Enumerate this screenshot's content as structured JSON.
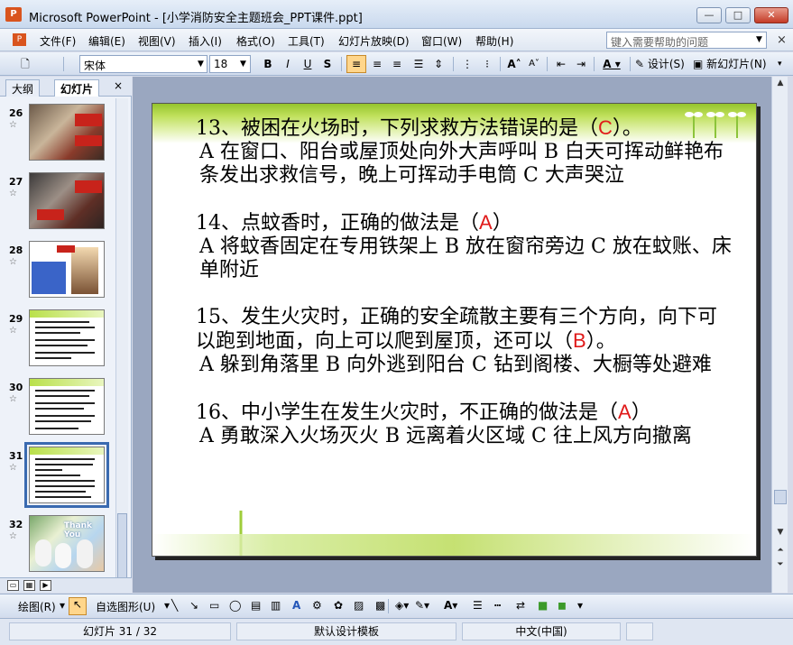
{
  "window": {
    "app_icon": "ppt-icon",
    "title": "Microsoft PowerPoint - [小学消防安全主题班会_PPT课件.ppt]",
    "minimize": "—",
    "maximize": "□",
    "close": "✕"
  },
  "menu": {
    "items": [
      "文件(F)",
      "编辑(E)",
      "视图(V)",
      "插入(I)",
      "格式(O)",
      "工具(T)",
      "幻灯片放映(D)",
      "窗口(W)",
      "帮助(H)"
    ],
    "help_placeholder": "键入需要帮助的问题",
    "close": "×"
  },
  "toolbar": {
    "font": "宋体",
    "size": "18",
    "bold": "B",
    "italic": "I",
    "underline": "U",
    "shadow": "S",
    "design": "设计(S)",
    "new_slide": "新幻灯片(N)"
  },
  "left_pane": {
    "tab_outline": "大纲",
    "tab_slides": "幻灯片",
    "close": "×",
    "slides": [
      {
        "num": "26",
        "star": "☆"
      },
      {
        "num": "27",
        "star": "☆"
      },
      {
        "num": "28",
        "star": "☆"
      },
      {
        "num": "29",
        "star": "☆"
      },
      {
        "num": "30",
        "star": "☆"
      },
      {
        "num": "31",
        "star": "☆"
      },
      {
        "num": "32",
        "star": "☆"
      }
    ],
    "selected_slide": "31",
    "thumb_32_text": "Thank You"
  },
  "slide": {
    "questions": [
      {
        "stem_before": "13、被困在火场时，下列求救方法错误的是（",
        "answer": "C",
        "stem_after": "）。",
        "options": "A 在窗口、阳台或屋顶处向外大声呼叫 B 白天可挥动鲜艳布条发出求救信号，晚上可挥动手电筒 C 大声哭泣"
      },
      {
        "stem_before": "14、点蚊香时，正确的做法是（",
        "answer": "A",
        "stem_after": "）",
        "options": "A 将蚊香固定在专用铁架上 B 放在窗帘旁边 C 放在蚊账、床单附近"
      },
      {
        "stem_before": "15、发生火灾时，正确的安全疏散主要有三个方向，向下可以跑到地面，向上可以爬到屋顶，还可以（",
        "answer": "B",
        "stem_after": "）。",
        "options": "A 躲到角落里 B 向外逃到阳台 C 钻到阁楼、大橱等处避难"
      },
      {
        "stem_before": "16、中小学生在发生火灾时，不正确的做法是（",
        "answer": "A",
        "stem_after": "）",
        "options": "A 勇敢深入火场灭火 B 远离着火区域 C 往上风方向撤离"
      }
    ]
  },
  "drawbar": {
    "draw": "绘图(R)",
    "autoshapes": "自选图形(U)"
  },
  "status": {
    "slide": "幻灯片 31 / 32",
    "template": "默认设计模板",
    "language": "中文(中国)"
  },
  "colors": {
    "answer": "#e01a1a",
    "accent_green": "#a8d23a",
    "selection": "#3a6ab0"
  }
}
